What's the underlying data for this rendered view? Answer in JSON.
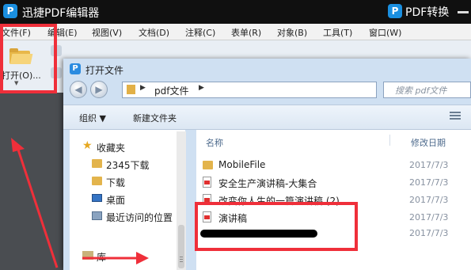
{
  "app": {
    "logo": "P",
    "title": "迅捷PDF编辑器",
    "brand_logo": "P",
    "brand_text": "PDF转换"
  },
  "menu": [
    "文件(F)",
    "编辑(E)",
    "视图(V)",
    "文档(D)",
    "注释(C)",
    "表单(R)",
    "对象(B)",
    "工具(T)",
    "窗口(W)"
  ],
  "toolbar": {
    "open_label": "打开(O)...",
    "open_arrow": "▼"
  },
  "dialog": {
    "title": "打开文件",
    "icon_letter": "P",
    "back_arrow": "◀",
    "forward_arrow": "▶",
    "breadcrumb_sep": "▶",
    "breadcrumb": "pdf文件",
    "search_placeholder": "搜索 pdf文件",
    "organize": "组织 ▼",
    "new_folder": "新建文件夹",
    "nav": {
      "favorites": "收藏夹",
      "items": [
        "2345下载",
        "下载",
        "桌面",
        "最近访问的位置"
      ],
      "library": "库"
    },
    "columns": {
      "name": "名称",
      "modified": "修改日期"
    },
    "files": [
      {
        "type": "folder",
        "name": "MobileFile",
        "date": "2017/7/3"
      },
      {
        "type": "pdf",
        "name": "安全生产演讲稿-大集合",
        "date": "2017/7/3"
      },
      {
        "type": "pdf",
        "name": "改变你人生的一篇演讲稿 (2)",
        "date": "2017/7/3"
      },
      {
        "type": "pdf",
        "name": "演讲稿",
        "date": "2017/7/3"
      },
      {
        "type": "redacted",
        "name": "",
        "date": "2017/7/3"
      }
    ]
  },
  "annotation_color": "#ef2f3a"
}
